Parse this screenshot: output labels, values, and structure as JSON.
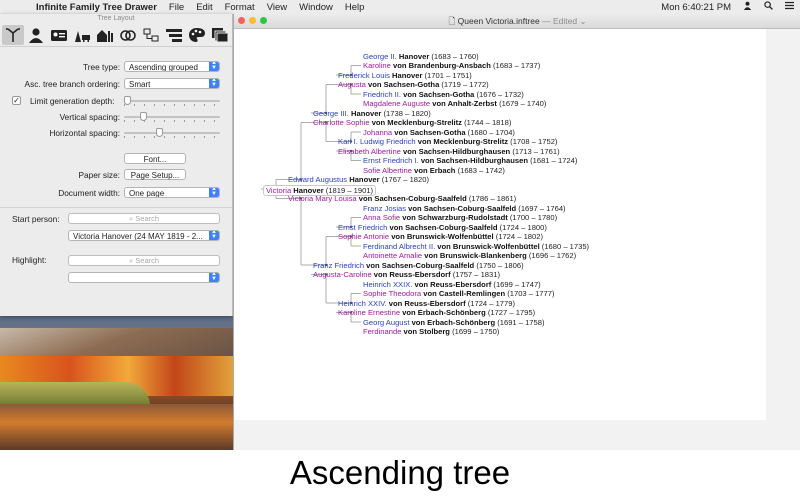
{
  "menubar": {
    "app_name": "Infinite Family Tree Drawer",
    "items": [
      "File",
      "Edit",
      "Format",
      "View",
      "Window",
      "Help"
    ],
    "clock": "Mon 6:40:21 PM"
  },
  "panel": {
    "title": "Tree Layout",
    "tree_type_label": "Tree type:",
    "tree_type_value": "Ascending grouped",
    "branch_order_label": "Asc. tree branch ordering:",
    "branch_order_value": "Smart",
    "limit_depth_label": "Limit generation depth:",
    "limit_depth_check": "✓",
    "vertical_spacing_label": "Vertical spacing:",
    "horizontal_spacing_label": "Horizontal spacing:",
    "font_button": "Font...",
    "paper_size_label": "Paper size:",
    "page_setup_button": "Page Setup...",
    "doc_width_label": "Document width:",
    "doc_width_value": "One page",
    "start_person_label": "Start person:",
    "start_person_search": "Search",
    "start_person_value": "Victoria Hanover (24 MAY 1819 - 2...",
    "highlight_label": "Highlight:",
    "highlight_search": "Search",
    "highlight_value": ""
  },
  "document": {
    "filename": "Queen Victoria.inftree",
    "status": "— Edited ⌄"
  },
  "tree": [
    {
      "g": "George II.",
      "f": "Hanover",
      "d": "(1683 – 1760)",
      "sex": "male"
    },
    {
      "g": "Karoline",
      "f": "von Brandenburg-Ansbach",
      "d": "(1683 – 1737)",
      "sex": "female"
    },
    {
      "g": "Frederick Louis",
      "f": "Hanover",
      "d": "(1701 – 1751)",
      "sex": "male"
    },
    {
      "g": "Augusta",
      "f": "von Sachsen-Gotha",
      "d": "(1719 – 1772)",
      "sex": "female"
    },
    {
      "g": "Friedrich II.",
      "f": "von Sachsen-Gotha",
      "d": "(1676 – 1732)",
      "sex": "male"
    },
    {
      "g": "Magdalene Auguste",
      "f": "von Anhalt-Zerbst",
      "d": "(1679 – 1740)",
      "sex": "female"
    },
    {
      "g": "George III.",
      "f": "Hanover",
      "d": "(1738 – 1820)",
      "sex": "male"
    },
    {
      "g": "Charlotte Sophie",
      "f": "von Mecklenburg-Strelitz",
      "d": "(1744 – 1818)",
      "sex": "female"
    },
    {
      "g": "Johanna",
      "f": "von Sachsen-Gotha",
      "d": "(1680 – 1704)",
      "sex": "female"
    },
    {
      "g": "Karl I. Ludwig Friedrich",
      "f": "von Mecklenburg-Strelitz",
      "d": "(1708 – 1752)",
      "sex": "male"
    },
    {
      "g": "Elisabeth Albertine",
      "f": "von Sachsen-Hildburghausen",
      "d": "(1713 – 1761)",
      "sex": "female"
    },
    {
      "g": "Ernst Friedrich I.",
      "f": "von Sachsen-Hildburghausen",
      "d": "(1681 – 1724)",
      "sex": "male"
    },
    {
      "g": "Sofie Albertine",
      "f": "von Erbach",
      "d": "(1683 – 1742)",
      "sex": "female"
    },
    {
      "g": "Edward Augustus",
      "f": "Hanover",
      "d": "(1767 – 1820)",
      "sex": "male"
    },
    {
      "g": "Victoria",
      "f": "Hanover",
      "d": "(1819 – 1901)",
      "sex": "female"
    },
    {
      "g": "Victoria Mary Louisa",
      "f": "von Sachsen-Coburg-Saalfeld",
      "d": "(1786 – 1861)",
      "sex": "female"
    },
    {
      "g": "Franz Josias",
      "f": "von Sachsen-Coburg-Saalfeld",
      "d": "(1697 – 1764)",
      "sex": "male"
    },
    {
      "g": "Anna Sofie",
      "f": "von Schwarzburg-Rudolstadt",
      "d": "(1700 – 1780)",
      "sex": "female"
    },
    {
      "g": "Ernst Friedrich",
      "f": "von Sachsen-Coburg-Saalfeld",
      "d": "(1724 – 1800)",
      "sex": "male"
    },
    {
      "g": "Sophie Antonie",
      "f": "von Brunswick-Wolfenbüttel",
      "d": "(1724 – 1802)",
      "sex": "female"
    },
    {
      "g": "Ferdinand Albrecht II.",
      "f": "von Brunswick-Wolfenbüttel",
      "d": "(1680 – 1735)",
      "sex": "male"
    },
    {
      "g": "Antoinette Amalie",
      "f": "von Brunswick-Blankenberg",
      "d": "(1696 – 1762)",
      "sex": "female"
    },
    {
      "g": "Franz Friedrich",
      "f": "von Sachsen-Coburg-Saalfeld",
      "d": "(1750 – 1806)",
      "sex": "male"
    },
    {
      "g": "Augusta-Caroline",
      "f": "von Reuss-Ebersdorf",
      "d": "(1757 – 1831)",
      "sex": "female"
    },
    {
      "g": "Heinrich XXIX.",
      "f": "von Reuss-Ebersdorf",
      "d": "(1699 – 1747)",
      "sex": "male"
    },
    {
      "g": "Sophie Theodora",
      "f": "von Castell-Remlingen",
      "d": "(1703 – 1777)",
      "sex": "female"
    },
    {
      "g": "Heinrich XXIV.",
      "f": "von Reuss-Ebersdorf",
      "d": "(1724 – 1779)",
      "sex": "male"
    },
    {
      "g": "Karoline Ernestine",
      "f": "von Erbach-Schönberg",
      "d": "(1727 – 1795)",
      "sex": "female"
    },
    {
      "g": "Georg August",
      "f": "von Erbach-Schönberg",
      "d": "(1691 – 1758)",
      "sex": "male"
    },
    {
      "g": "Ferdinande",
      "f": "von Stolberg",
      "d": "(1699 – 1750)",
      "sex": "female"
    }
  ],
  "caption": "Ascending tree",
  "colors": {
    "male": "#2b3fc2",
    "female": "#a21aa0",
    "accent": "#3e82f7"
  },
  "icons": [
    "apple-icon",
    "user-icon",
    "spotlight-icon",
    "menu-list-icon"
  ]
}
